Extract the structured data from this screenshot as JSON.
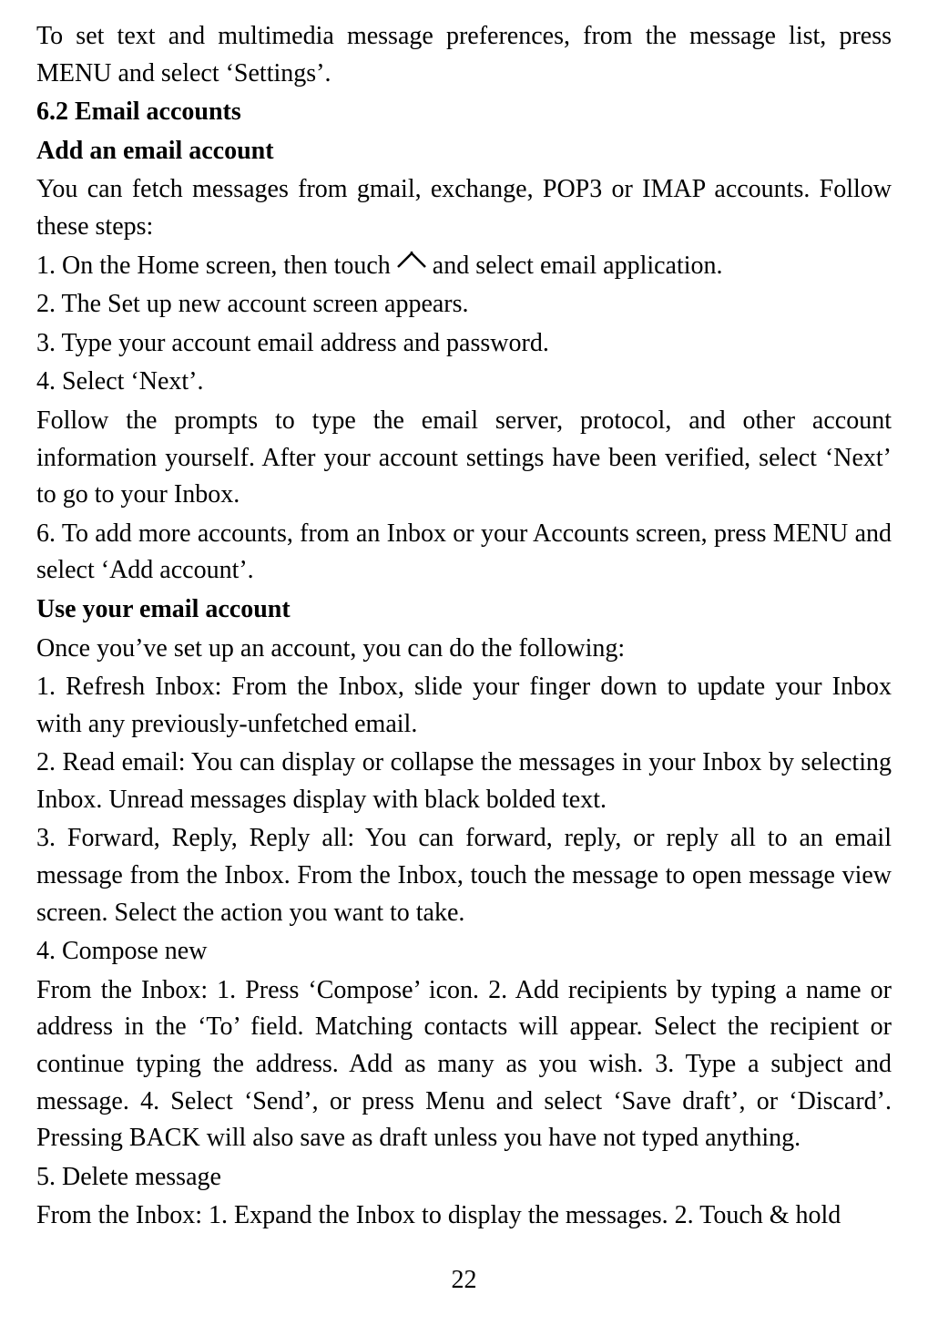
{
  "page": {
    "page_number": "22",
    "paragraphs": [
      {
        "id": "intro-line",
        "type": "normal",
        "text": "To set text and multimedia message preferences, from the message list, press MENU and select ‘Settings’."
      },
      {
        "id": "heading-email-accounts",
        "type": "bold-heading",
        "text": "6.2 Email accounts"
      },
      {
        "id": "heading-add-account",
        "type": "bold-heading",
        "text": "Add an email account"
      },
      {
        "id": "add-account-intro",
        "type": "normal",
        "text": "You can fetch messages from gmail, exchange, POP3 or IMAP accounts. Follow these steps:"
      },
      {
        "id": "step1",
        "type": "normal-with-icon",
        "text_before": "1. On the Home screen, then touch ",
        "text_after": " and select email application."
      },
      {
        "id": "step2",
        "type": "normal",
        "text": "2. The Set up new account screen appears."
      },
      {
        "id": "step3",
        "type": "normal",
        "text": "3. Type your account email address and password."
      },
      {
        "id": "step4",
        "type": "normal",
        "text": "4. Select ‘Next’."
      },
      {
        "id": "step5-followup",
        "type": "normal",
        "text": "Follow the prompts to type the email server, protocol, and other account information yourself. After your account settings have been verified, select ‘Next’ to go to your Inbox."
      },
      {
        "id": "step6",
        "type": "normal",
        "text": "6. To add more accounts, from an Inbox or your Accounts screen, press MENU and select ‘Add account’."
      },
      {
        "id": "heading-use-account",
        "type": "bold-heading",
        "text": "Use your email account"
      },
      {
        "id": "use-account-intro",
        "type": "normal",
        "text": "Once you’ve set up an account, you can do the following:"
      },
      {
        "id": "use-step1",
        "type": "normal",
        "text": "1. Refresh Inbox: From the Inbox, slide your finger down to update your Inbox with any previously-unfetched email."
      },
      {
        "id": "use-step2",
        "type": "normal",
        "text": "2. Read email: You can display or collapse the messages in your Inbox by selecting Inbox. Unread messages display with black bolded text."
      },
      {
        "id": "use-step3",
        "type": "normal",
        "text": "3. Forward, Reply, Reply all: You can forward, reply, or reply all to an email message from the Inbox. From the Inbox, touch the message to open message view screen. Select the action you want to take."
      },
      {
        "id": "use-step4-label",
        "type": "normal",
        "text": "4. Compose new"
      },
      {
        "id": "use-step4-detail",
        "type": "normal",
        "text": "From the Inbox: 1. Press ‘Compose’ icon. 2. Add recipients by typing a name or address in the ‘To’ field. Matching contacts will appear. Select the recipient or continue typing the address. Add as many as you wish. 3. Type a subject and message. 4. Select ‘Send’, or press Menu and select ‘Save draft’, or ‘Discard’. Pressing BACK will also save as draft unless you have not typed anything."
      },
      {
        "id": "use-step5-label",
        "type": "normal",
        "text": "5. Delete message"
      },
      {
        "id": "use-step5-detail",
        "type": "normal",
        "text": "From the Inbox: 1. Expand the Inbox to display the messages. 2. Touch & hold"
      }
    ]
  }
}
